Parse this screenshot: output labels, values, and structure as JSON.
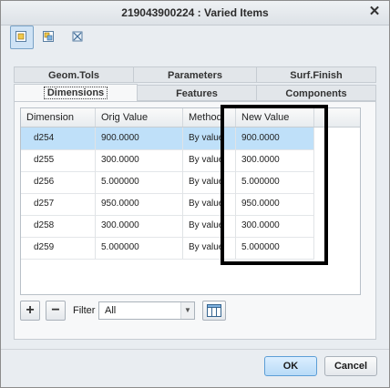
{
  "window": {
    "title": "219043900224 : Varied Items",
    "close_glyph": "✕"
  },
  "toolbar": {
    "icons": [
      "view-a-icon",
      "view-b-icon",
      "filter-off-icon"
    ]
  },
  "tabs": {
    "top": [
      "Geom.Tols",
      "Parameters",
      "Surf.Finish"
    ],
    "bottom": [
      "Dimensions",
      "Features",
      "Components"
    ],
    "selected": "Dimensions"
  },
  "table": {
    "headers": [
      "Dimension",
      "Orig Value",
      "Method",
      "New Value"
    ],
    "rows": [
      [
        "d254",
        "900.0000",
        "By value",
        "900.0000"
      ],
      [
        "d255",
        "300.0000",
        "By value",
        "300.0000"
      ],
      [
        "d256",
        "5.000000",
        "By value",
        "5.000000"
      ],
      [
        "d257",
        "950.0000",
        "By value",
        "950.0000"
      ],
      [
        "d258",
        "300.0000",
        "By value",
        "300.0000"
      ],
      [
        "d259",
        "5.000000",
        "By value",
        "5.000000"
      ]
    ],
    "selected_row": 0
  },
  "filter": {
    "label": "Filter",
    "value": "All",
    "add_glyph": "+",
    "remove_glyph": "−"
  },
  "buttons": {
    "ok": "OK",
    "cancel": "Cancel"
  },
  "colors": {
    "selected_row": "#bfe0f9",
    "ok_button": "#b8dbf7"
  }
}
